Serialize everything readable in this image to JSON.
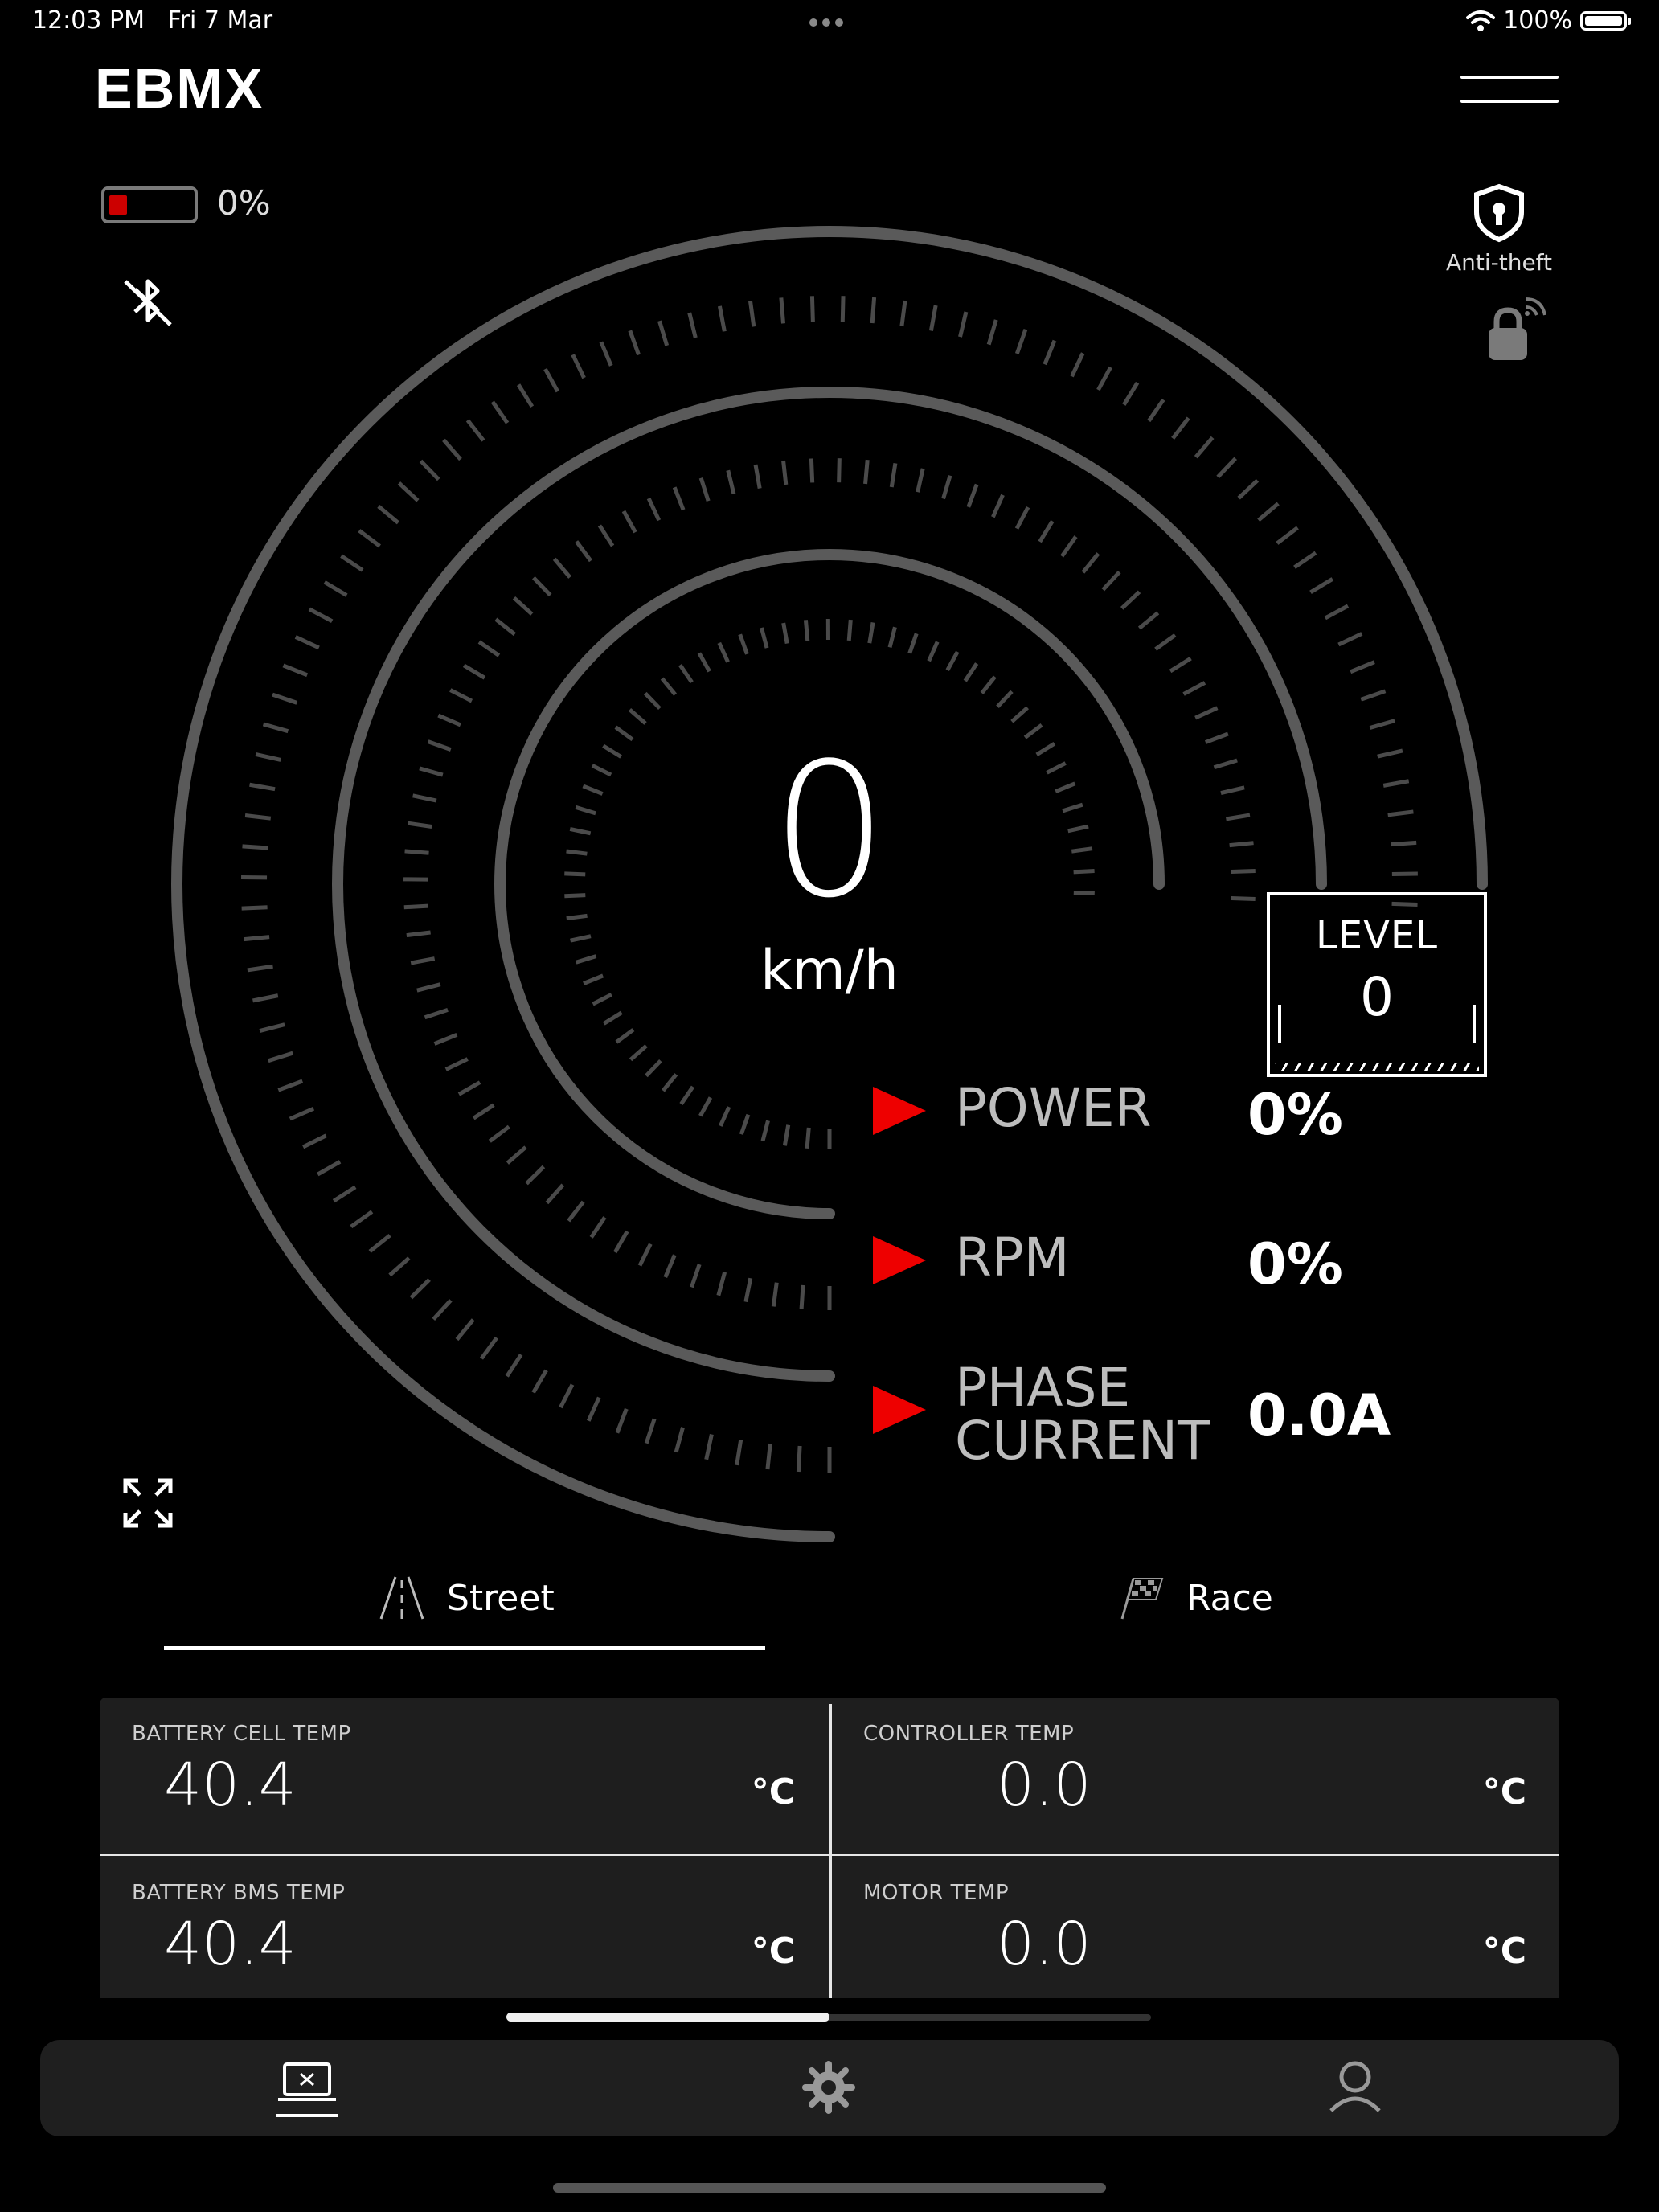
{
  "status_bar": {
    "time": "12:03 PM",
    "date": "Fri 7 Mar",
    "battery": "100%"
  },
  "header": {
    "logo": "EBMX"
  },
  "ebike_battery": {
    "percent_label": "0%",
    "level": 0.2
  },
  "anti_theft": {
    "label": "Anti-theft"
  },
  "speedometer": {
    "speed": "0",
    "unit": "km/h"
  },
  "level": {
    "label": "LEVEL",
    "value": "0"
  },
  "metrics": [
    {
      "label": "POWER",
      "value": "0%"
    },
    {
      "label": "RPM",
      "value": "0%"
    },
    {
      "label_line1": "PHASE",
      "label_line2": "CURRENT",
      "value": "0.0A"
    }
  ],
  "modes": {
    "street": "Street",
    "race": "Race",
    "selected": "Street"
  },
  "temps": [
    {
      "label": "BATTERY CELL TEMP",
      "value": "40.4",
      "unit": "°C"
    },
    {
      "label": "CONTROLLER TEMP",
      "value": "0.0",
      "unit": "°C"
    },
    {
      "label": "BATTERY BMS TEMP",
      "value": "40.4",
      "unit": "°C"
    },
    {
      "label": "MOTOR TEMP",
      "value": "0.0",
      "unit": "°C"
    }
  ],
  "bottom_nav": {
    "items": [
      "dashboard-icon",
      "settings-icon",
      "profile-icon"
    ],
    "active": "dashboard-icon"
  },
  "colors": {
    "background": "#000000",
    "accent_red": "#e00000",
    "arc_gray": "#5a5a5a",
    "panel": "#1e1e1e"
  }
}
